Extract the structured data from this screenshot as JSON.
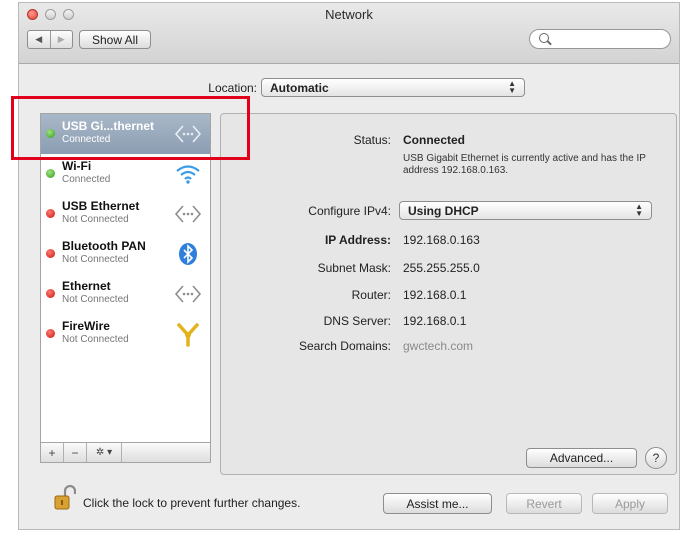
{
  "window": {
    "title": "Network"
  },
  "toolbar": {
    "back_glyph": "◀",
    "forward_glyph": "▶",
    "show_all_label": "Show All",
    "search_value": "",
    "search_placeholder": ""
  },
  "location": {
    "label": "Location:",
    "value": "Automatic"
  },
  "services": [
    {
      "name": "USB Gi...thernet",
      "status": "Connected",
      "dot": "green",
      "icon": "ethernet-icon",
      "selected": true
    },
    {
      "name": "Wi-Fi",
      "status": "Connected",
      "dot": "green",
      "icon": "wifi-icon",
      "selected": false
    },
    {
      "name": "USB Ethernet",
      "status": "Not Connected",
      "dot": "red",
      "icon": "ethernet-icon",
      "selected": false
    },
    {
      "name": "Bluetooth PAN",
      "status": "Not Connected",
      "dot": "red",
      "icon": "bluetooth-icon",
      "selected": false
    },
    {
      "name": "Ethernet",
      "status": "Not Connected",
      "dot": "red",
      "icon": "ethernet-icon",
      "selected": false
    },
    {
      "name": "FireWire",
      "status": "Not Connected",
      "dot": "red",
      "icon": "firewire-icon",
      "selected": false
    }
  ],
  "sidebar_controls": {
    "add": "+",
    "remove": "−",
    "gear": "✲ ▾"
  },
  "detail": {
    "status_label": "Status:",
    "status_value": "Connected",
    "status_desc": "USB Gigabit Ethernet is currently active and has the IP address 192.168.0.163.",
    "configure_label": "Configure IPv4:",
    "configure_value": "Using DHCP",
    "ip_label": "IP Address:",
    "ip_value": "192.168.0.163",
    "subnet_label": "Subnet Mask:",
    "subnet_value": "255.255.255.0",
    "router_label": "Router:",
    "router_value": "192.168.0.1",
    "dns_label": "DNS Server:",
    "dns_value": "192.168.0.1",
    "search_domains_label": "Search Domains:",
    "search_domains_value": "gwctech.com",
    "advanced_label": "Advanced...",
    "help_label": "?"
  },
  "footer": {
    "lock_text": "Click the lock to prevent further changes.",
    "assist_label": "Assist me...",
    "revert_label": "Revert",
    "apply_label": "Apply"
  },
  "colors": {
    "selected_row": "#8b9db2",
    "highlight_box": "#e3001b",
    "connected_dot": "#2f9a1b",
    "disconnected_dot": "#c8120a"
  }
}
